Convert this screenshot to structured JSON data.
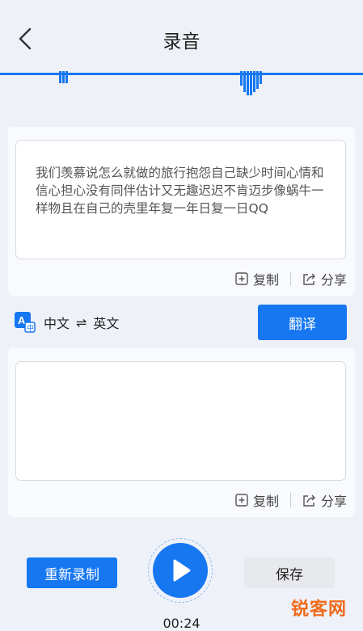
{
  "header": {
    "title": "录音"
  },
  "source": {
    "text": "我们羡慕说怎么就做的旅行抱怨自己缺少时间心情和信心担心没有同伴估计又无趣迟迟不肯迈步像蜗牛一样物且在自己的壳里年复一年日复一日QQ",
    "copy_label": "复制",
    "share_label": "分享"
  },
  "language": {
    "from": "中文",
    "swap": "⇌",
    "to": "英文"
  },
  "translate_label": "翻译",
  "target": {
    "text": "",
    "copy_label": "复制",
    "share_label": "分享"
  },
  "controls": {
    "rerecord_label": "重新录制",
    "save_label": "保存",
    "time": "00:24"
  },
  "watermark": "锐客网",
  "colors": {
    "accent": "#1677f1",
    "background": "#eef2f8",
    "logo": "#f06a1a"
  },
  "icons": {
    "back": "chevron-left-icon",
    "copy": "copy-icon",
    "share": "share-icon",
    "translate": "translate-icon",
    "play": "play-icon"
  }
}
